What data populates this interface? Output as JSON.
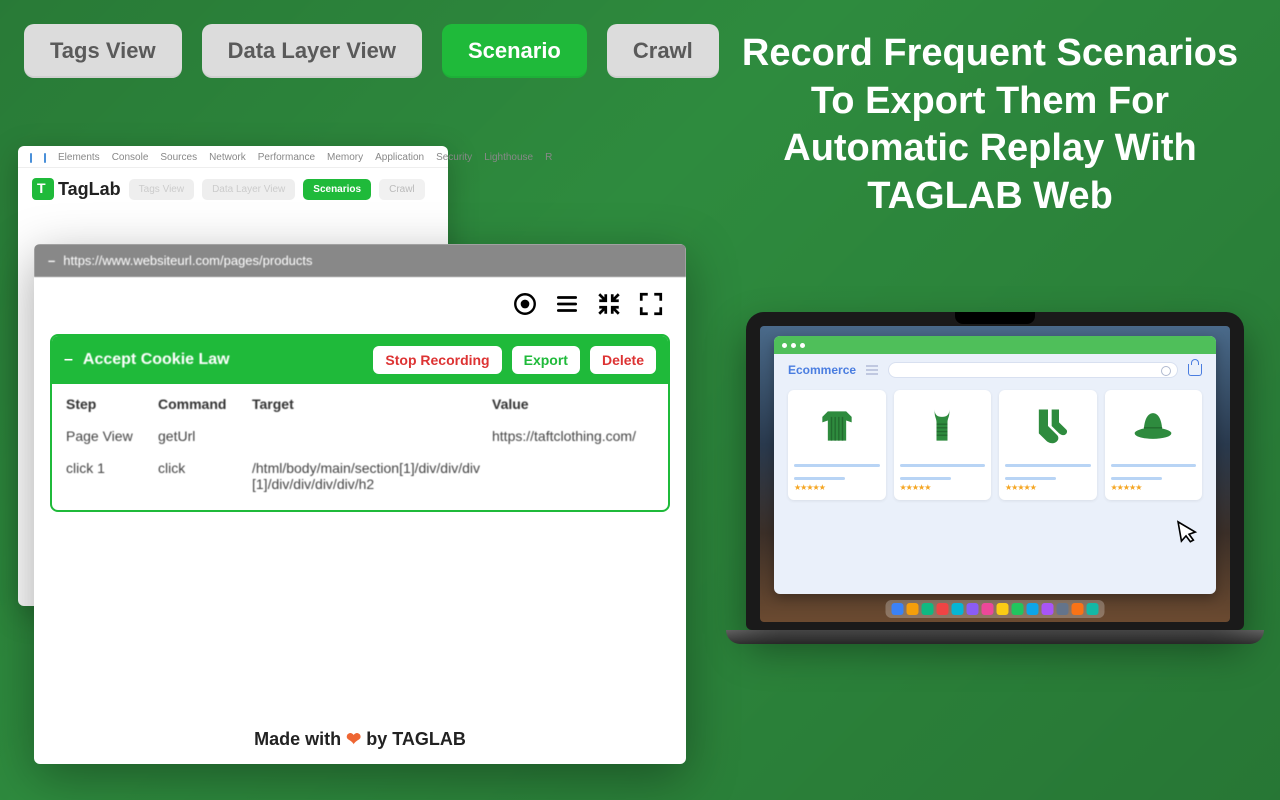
{
  "top_tabs": {
    "tags_view": "Tags View",
    "data_layer_view": "Data Layer View",
    "scenario": "Scenario",
    "crawl": "Crawl"
  },
  "headline": "Record Frequent Scenarios To Export Them For Automatic Replay With TAGLAB Web",
  "devtools": {
    "tabs": [
      "Elements",
      "Console",
      "Sources",
      "Network",
      "Performance",
      "Memory",
      "Application",
      "Security",
      "Lighthouse",
      "R"
    ],
    "brand": "TagLab",
    "mini_tabs": {
      "tags_view": "Tags View",
      "data_layer_view": "Data Layer View",
      "scenarios": "Scenarios",
      "crawl": "Crawl"
    }
  },
  "scenario": {
    "url": "https://www.websiteurl.com/pages/products",
    "title": "Accept Cookie Law",
    "buttons": {
      "stop": "Stop Recording",
      "export": "Export",
      "delete": "Delete"
    },
    "columns": {
      "step": "Step",
      "command": "Command",
      "target": "Target",
      "value": "Value"
    },
    "rows": [
      {
        "step": "Page View",
        "command": "getUrl",
        "target": "",
        "value": "https://taftclothing.com/"
      },
      {
        "step": "click 1",
        "command": "click",
        "target": "/html/body/main/section[1]/div/div/div[1]/div/div/div/div/h2",
        "value": ""
      }
    ]
  },
  "footer": {
    "made": "Made with ",
    "by": " by TAGLAB"
  },
  "laptop": {
    "brand": "Ecommerce"
  },
  "colors": {
    "accent": "#1fba3a"
  }
}
